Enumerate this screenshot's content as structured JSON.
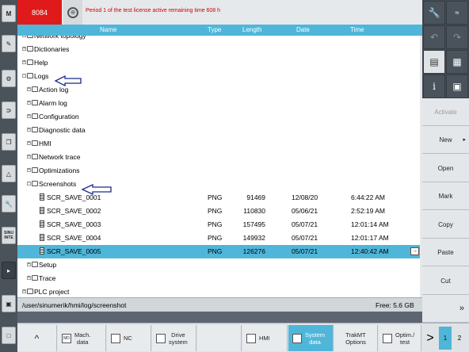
{
  "header": {
    "channel": "8084",
    "license_message": "Period 1 of the test license active remaining time 608 h"
  },
  "columns": {
    "name": "Name",
    "type": "Type",
    "length": "Length",
    "date": "Date",
    "time": "Time"
  },
  "tree": [
    {
      "label": "Network topology",
      "level": 1,
      "kind": "folder",
      "expander": "+"
    },
    {
      "label": "Dictionaries",
      "level": 1,
      "kind": "folder",
      "expander": "+"
    },
    {
      "label": "Help",
      "level": 1,
      "kind": "folder",
      "expander": "+"
    },
    {
      "label": "Logs",
      "level": 1,
      "kind": "folder",
      "expander": "-"
    },
    {
      "label": "Action log",
      "level": 2,
      "kind": "folder",
      "expander": "+"
    },
    {
      "label": "Alarm log",
      "level": 2,
      "kind": "folder",
      "expander": "+"
    },
    {
      "label": "Configuration",
      "level": 2,
      "kind": "folder",
      "expander": "+"
    },
    {
      "label": "Diagnostic data",
      "level": 2,
      "kind": "folder",
      "expander": "+"
    },
    {
      "label": "HMI",
      "level": 2,
      "kind": "folder",
      "expander": "+"
    },
    {
      "label": "Network trace",
      "level": 2,
      "kind": "folder",
      "expander": "+"
    },
    {
      "label": "Optimizations",
      "level": 2,
      "kind": "folder",
      "expander": "+"
    },
    {
      "label": "Screenshots",
      "level": 2,
      "kind": "folder",
      "expander": "-"
    },
    {
      "label": "SCR_SAVE_0001",
      "level": 3,
      "kind": "file",
      "type": "PNG",
      "length": "91469",
      "date": "12/08/20",
      "time": "6:44:22 AM"
    },
    {
      "label": "SCR_SAVE_0002",
      "level": 3,
      "kind": "file",
      "type": "PNG",
      "length": "110830",
      "date": "05/06/21",
      "time": "2:52:19 AM"
    },
    {
      "label": "SCR_SAVE_0003",
      "level": 3,
      "kind": "file",
      "type": "PNG",
      "length": "157495",
      "date": "05/07/21",
      "time": "12:01:14 AM"
    },
    {
      "label": "SCR_SAVE_0004",
      "level": 3,
      "kind": "file",
      "type": "PNG",
      "length": "149932",
      "date": "05/07/21",
      "time": "12:01:17 AM"
    },
    {
      "label": "SCR_SAVE_0005",
      "level": 3,
      "kind": "file",
      "type": "PNG",
      "length": "126276",
      "date": "05/07/21",
      "time": "12:40:42 AM",
      "selected": true
    },
    {
      "label": "Setup",
      "level": 2,
      "kind": "folder",
      "expander": "+"
    },
    {
      "label": "Trace",
      "level": 2,
      "kind": "folder",
      "expander": "+"
    },
    {
      "label": "PLC project",
      "level": 1,
      "kind": "folder",
      "expander": "+"
    }
  ],
  "status": {
    "path": "/user/sinumerik/hmi/log/screenshot",
    "free": "Free: 5.6 GB"
  },
  "softkeys": [
    "Activate",
    "New",
    "Open",
    "Mark",
    "Copy",
    "Paste",
    "Cut"
  ],
  "softkey_extra": "»",
  "hkeys": [
    {
      "icon": "MD",
      "label": "Mach.\ndata"
    },
    {
      "icon": "NC",
      "label": "NC"
    },
    {
      "icon": "DS",
      "label": "Drive\nsystem"
    },
    {
      "icon": "HMI",
      "label": "HMI"
    },
    {
      "icon": "SD",
      "label": "System\ndata",
      "active": true
    },
    {
      "icon": "",
      "label": "TrakMT\nOptions"
    },
    {
      "icon": "OT",
      "label": "Optim./\ntest"
    }
  ],
  "paging": {
    "arrow_left": "^",
    "arrow_right": ">",
    "page1": "1",
    "page2": "2"
  },
  "left_keys": [
    "M",
    "",
    "",
    "",
    "",
    "",
    "",
    "SINU\nINTE"
  ],
  "right_icons": [
    "wrench-icon",
    "signal-icon",
    "undo-icon",
    "redo-icon",
    "window-icon",
    "calculator-icon",
    "info-icon",
    "camera-icon"
  ],
  "colors": {
    "accent": "#4fb6d9",
    "alarm": "#e01a1a",
    "panel_dark": "#4a525a"
  }
}
